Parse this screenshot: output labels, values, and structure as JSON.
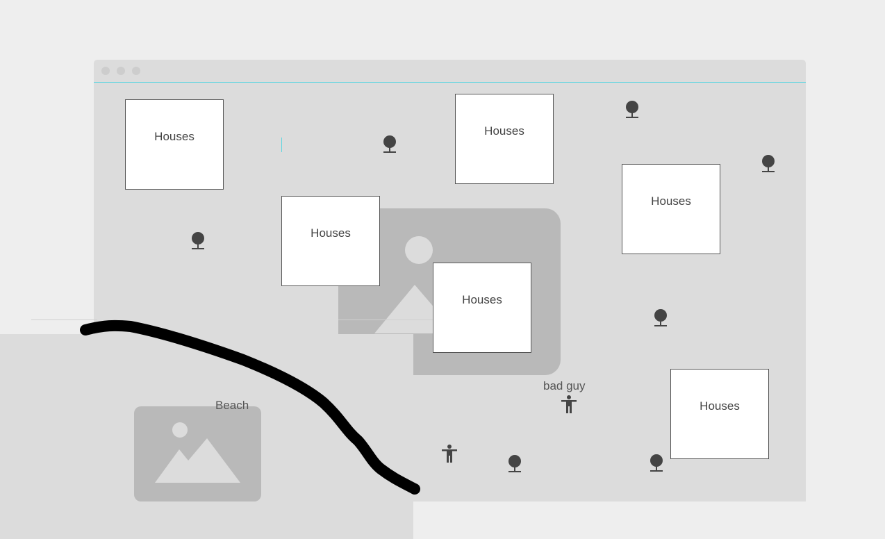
{
  "houses_label": "Houses",
  "houses": [
    {
      "label": "Houses"
    },
    {
      "label": "Houses"
    },
    {
      "label": "Houses"
    },
    {
      "label": "Houses"
    },
    {
      "label": "Houses"
    },
    {
      "label": "Houses"
    }
  ],
  "labels": {
    "beach": "Beach",
    "bad_guy": "bad guy"
  },
  "icons": {
    "tree": "tree-icon",
    "person": "person-icon",
    "image": "image-placeholder-icon"
  },
  "colors": {
    "house_fill": "#ffffff",
    "map_bg": "#dcdcdc",
    "placeholder": "#b9b9b9",
    "accent_line": "#5fd5e0",
    "icon": "#444444",
    "shoreline": "#000000"
  }
}
